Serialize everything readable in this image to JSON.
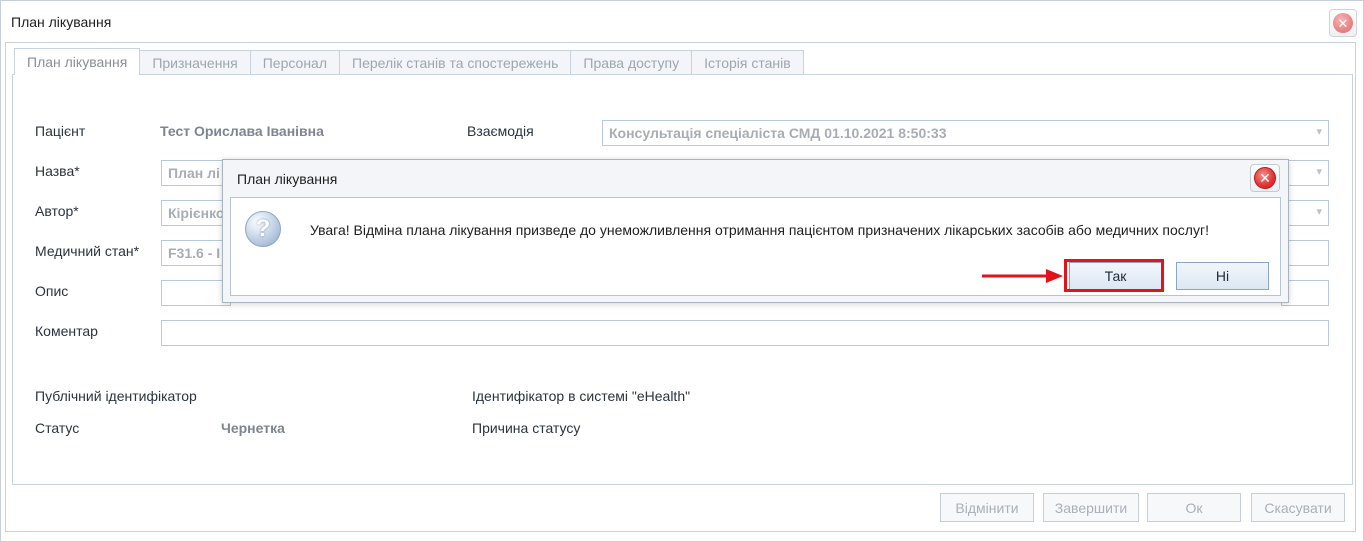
{
  "window": {
    "title": "План лікування"
  },
  "tabs": [
    {
      "label": "План лікування"
    },
    {
      "label": "Призначення"
    },
    {
      "label": "Персонал"
    },
    {
      "label": "Перелік станів та спостережень"
    },
    {
      "label": "Права доступу"
    },
    {
      "label": "Історія станів"
    }
  ],
  "form": {
    "patient_label": "Пацієнт",
    "patient_value": "Тест Орислава Іванівна",
    "interaction_label": "Взаємодія",
    "interaction_value": "Консультація спеціаліста СМД 01.10.2021 8:50:33",
    "name_label": "Назва*",
    "name_value": "План лі",
    "author_label": "Автор*",
    "author_value": "Кірієнко",
    "condition_label": "Медичний стан*",
    "condition_value": "F31.6 - I",
    "description_label": "Опис",
    "description_value": "",
    "comment_label": "Коментар",
    "comment_value": "",
    "public_id_label": "Публічний ідентифікатор",
    "ehealth_id_label": "Ідентифікатор в системі \"eHealth\"",
    "status_label": "Статус",
    "status_value": "Чернетка",
    "status_reason_label": "Причина статусу"
  },
  "footer": {
    "cancel_plan": "Відмінити",
    "complete": "Завершити",
    "ok": "Ок",
    "cancel": "Скасувати"
  },
  "dialog": {
    "title": "План лікування",
    "message": "Увага! Відміна плана лікування призведе до унеможливлення отримання пацієнтом призначених лікарських засобів або медичних послуг!",
    "yes": "Так",
    "no": "Ні",
    "icon": "question-icon"
  },
  "colors": {
    "highlight": "#e2131b",
    "accent_border": "#b7c9dc"
  }
}
